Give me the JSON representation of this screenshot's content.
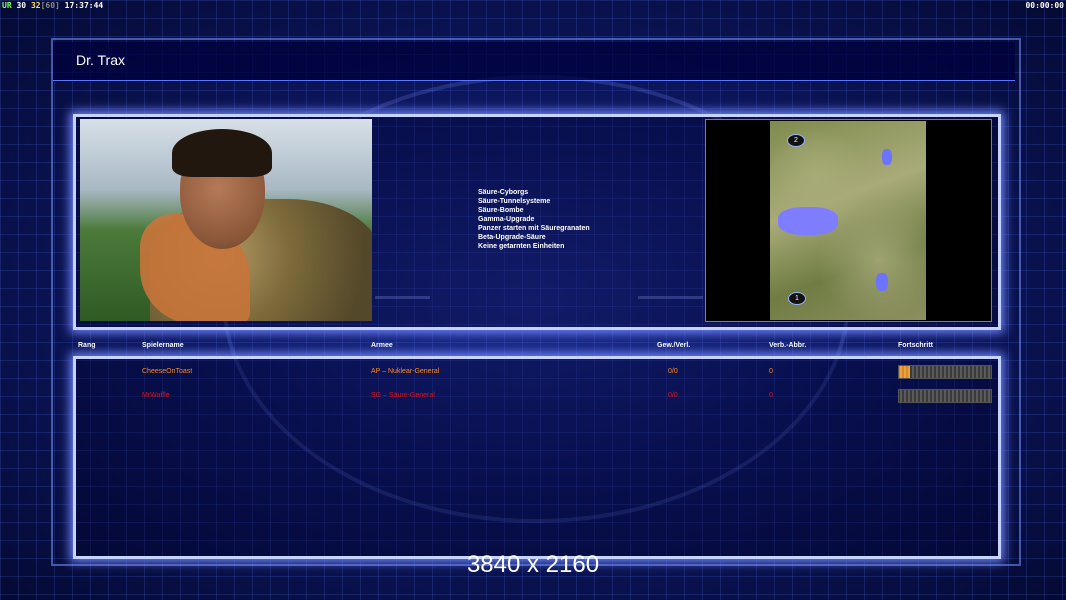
{
  "hud": {
    "ur": "UR",
    "fps": "30",
    "fps2": "32",
    "fps_limit": "[60]",
    "clock": "17:37:44",
    "timer": "00:00:00"
  },
  "title": "Dr. Trax",
  "upgrades": [
    "Säure-Cyborgs",
    "Säure-Tunnelsysteme",
    "Säure-Bombe",
    "Gamma-Upgrade",
    "Panzer starten mit Säuregranaten",
    "Beta-Upgrade-Säure",
    "Keine getarnten Einheiten"
  ],
  "map": {
    "markers": [
      "2",
      "1"
    ]
  },
  "table": {
    "headers": {
      "rank": "Rang",
      "player": "Spielername",
      "army": "Armee",
      "wins": "Gew./Verl.",
      "disconnects": "Verb.-Abbr.",
      "progress": "Fortschritt"
    },
    "rows": [
      {
        "rank": "",
        "player": "CheeseOnToast",
        "army": "AP – Nuklear-General",
        "wins": "0/0",
        "disconnects": "0",
        "progress": 0.12,
        "color": "#ff8c1a"
      },
      {
        "rank": "",
        "player": "MrWaffle",
        "army": "SG – Säure-General",
        "wins": "0/0",
        "disconnects": "0",
        "progress": 0.0,
        "color": "#e0101a"
      }
    ]
  },
  "resolution": "3840 x 2160"
}
